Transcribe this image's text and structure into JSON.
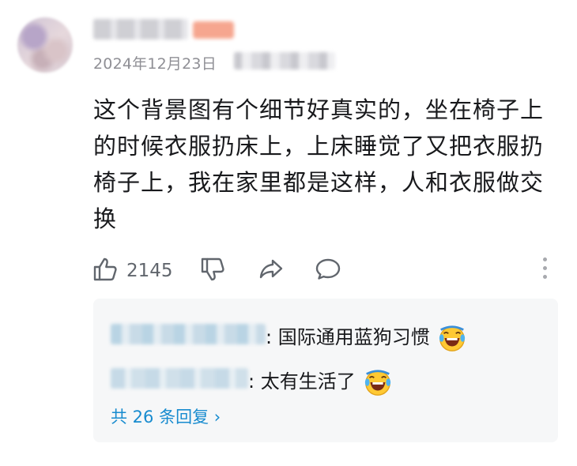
{
  "comment": {
    "date": "2024年12月23日",
    "text": "这个背景图有个细节好真实的，坐在椅子上的时候衣服扔床上，上床睡觉了又把衣服扔椅子上，我在家里都是这样，人和衣服做交换"
  },
  "actions": {
    "like_count": "2145",
    "icons": [
      "thumbs-up-icon",
      "thumbs-down-icon",
      "share-icon",
      "comment-icon",
      "more-icon"
    ]
  },
  "replies": {
    "items": [
      {
        "text": ": 国际通用蓝狗习惯",
        "emoji": "laughing-tears-emoji"
      },
      {
        "text": ": 太有生活了",
        "emoji": "laughing-tears-emoji"
      }
    ],
    "more_label": "共 26 条回复 ›"
  },
  "colors": {
    "link": "#178bcf",
    "secondary_text": "#8f8f95",
    "panel_bg": "#f6f7f8"
  }
}
